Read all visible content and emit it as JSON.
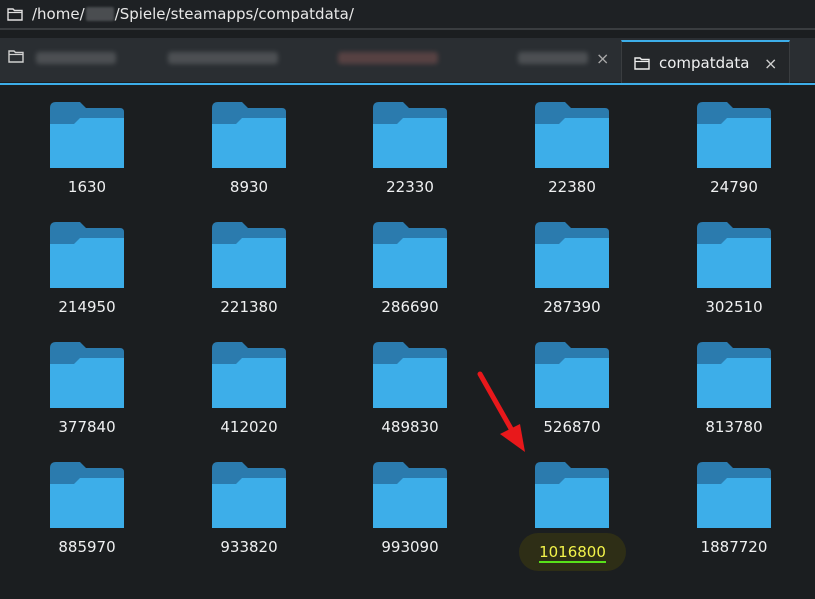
{
  "window": {
    "path_prefix": "/home/",
    "path_suffix": "/Spiele/steamapps/compatdata/"
  },
  "tabs": {
    "active_label": "compatdata",
    "close_symbol": "×"
  },
  "folders": [
    "1630",
    "8930",
    "22330",
    "22380",
    "24790",
    "214950",
    "221380",
    "286690",
    "287390",
    "302510",
    "377840",
    "412020",
    "489830",
    "526870",
    "813780",
    "885970",
    "933820",
    "993090",
    "1016800",
    "1887720"
  ],
  "highlighted_folder": "1016800",
  "colors": {
    "folder_front": "#3daee9",
    "folder_back": "#2b7bae",
    "accent": "#3daee9",
    "annotation_arrow": "#e8181b",
    "highlight_text": "#f3f34a"
  },
  "icons": [
    "folder-icon",
    "close-icon",
    "arrow-annotation"
  ]
}
